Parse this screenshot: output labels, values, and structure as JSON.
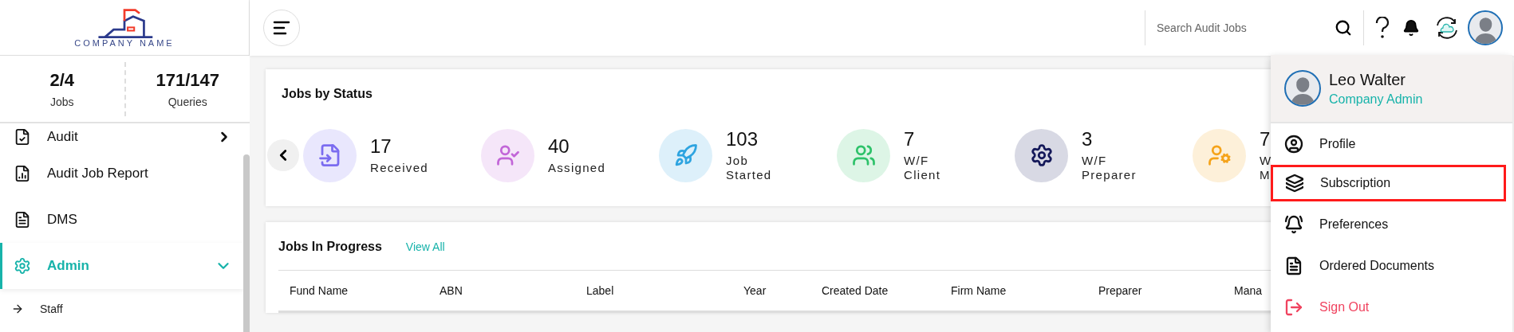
{
  "logo": {
    "text": "COMPANY NAME"
  },
  "header": {
    "search": {
      "placeholder": "Search Audit Jobs"
    }
  },
  "sidebar": {
    "stats": [
      {
        "value": "2/4",
        "label": "Jobs"
      },
      {
        "value": "171/147",
        "label": "Queries"
      }
    ],
    "items": [
      {
        "label": "Audit",
        "expanded": false,
        "selected": false
      },
      {
        "label": "Audit Job Report",
        "selected": false
      },
      {
        "label": "DMS",
        "selected": false
      },
      {
        "label": "Admin",
        "expanded": true,
        "selected": true,
        "children": [
          {
            "label": "Staff"
          }
        ]
      }
    ]
  },
  "jobs_by_status": {
    "title": "Jobs by Status",
    "items": [
      {
        "value": "17",
        "label": [
          "Received"
        ],
        "color": "#7b6cf0"
      },
      {
        "value": "40",
        "label": [
          "Assigned"
        ],
        "color": "#c266d8"
      },
      {
        "value": "103",
        "label": [
          "Job",
          "Started"
        ],
        "color": "#2ea4e0"
      },
      {
        "value": "7",
        "label": [
          "W/F",
          "Client"
        ],
        "color": "#2ec26a"
      },
      {
        "value": "3",
        "label": [
          "W/F",
          "Preparer"
        ],
        "color": "#15195a"
      },
      {
        "value": "7",
        "label": [
          "W",
          "M"
        ],
        "color": "#f5a31a"
      }
    ]
  },
  "jobs_in_progress": {
    "title": "Jobs In Progress",
    "link": "View All",
    "columns": [
      "Fund Name",
      "ABN",
      "Label",
      "Year",
      "Created Date",
      "Firm Name",
      "Preparer",
      "Mana"
    ]
  },
  "user_menu": {
    "name": "Leo Walter",
    "role": "Company Admin",
    "items": [
      {
        "label": "Profile",
        "kind": "normal",
        "selected": false
      },
      {
        "label": "Subscription",
        "kind": "normal",
        "selected": true
      },
      {
        "label": "Preferences",
        "kind": "normal",
        "selected": false
      },
      {
        "label": "Ordered Documents",
        "kind": "normal",
        "selected": false
      },
      {
        "label": "Sign Out",
        "kind": "danger",
        "selected": false
      }
    ]
  }
}
